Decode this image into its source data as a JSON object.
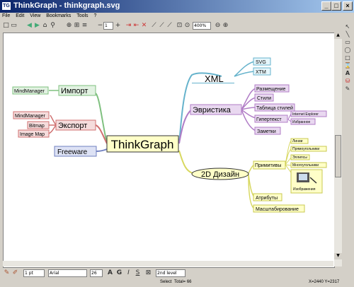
{
  "window": {
    "title": "ThinkGraph - thinkgraph.svg",
    "app_icon_text": "TG"
  },
  "menu": [
    "File",
    "Edit",
    "View",
    "Bookmarks",
    "Tools",
    "?"
  ],
  "toolbar": {
    "level_value": "1",
    "zoom_value": "400%"
  },
  "mindmap": {
    "center": "ThinkGraph",
    "xml": {
      "label": "XML",
      "children": [
        "SVG",
        "XTM"
      ]
    },
    "heuristics": {
      "label": "Эвристика",
      "children": [
        "Размещение",
        "Стили",
        "Таблица стилей",
        "Гипертекст",
        "Заметки"
      ],
      "hypertext_children": [
        "Internet Explorer",
        "Избранное"
      ]
    },
    "design": {
      "label": "2D Дизайн",
      "primitives": "Примитивы",
      "primitive_children": [
        "Линии",
        "Прямоугольники",
        "Эллипсы",
        "Многоугольники"
      ],
      "images": "Изображения",
      "children": [
        "Атрибуты",
        "Масштабирование"
      ]
    },
    "import": {
      "label": "Импорт",
      "children": [
        "MindManager"
      ]
    },
    "export": {
      "label": "Экспорт",
      "children": [
        "MindManager",
        "Bitmap",
        "Image Map"
      ]
    },
    "freeware": "Freeware"
  },
  "format": {
    "line_width": "1 pt",
    "font": "Arial",
    "font_size": "26",
    "style_level": "2nd level"
  },
  "status": {
    "mode": "Select",
    "total": "Total= 66",
    "coords": "X=2440  Y=2317"
  },
  "colors": {
    "xml": "#66b3cc",
    "heuristics": "#b07cc6",
    "design": "#d8d860",
    "import": "#7fc07f",
    "export": "#d07070",
    "freeware": "#7080c0"
  }
}
